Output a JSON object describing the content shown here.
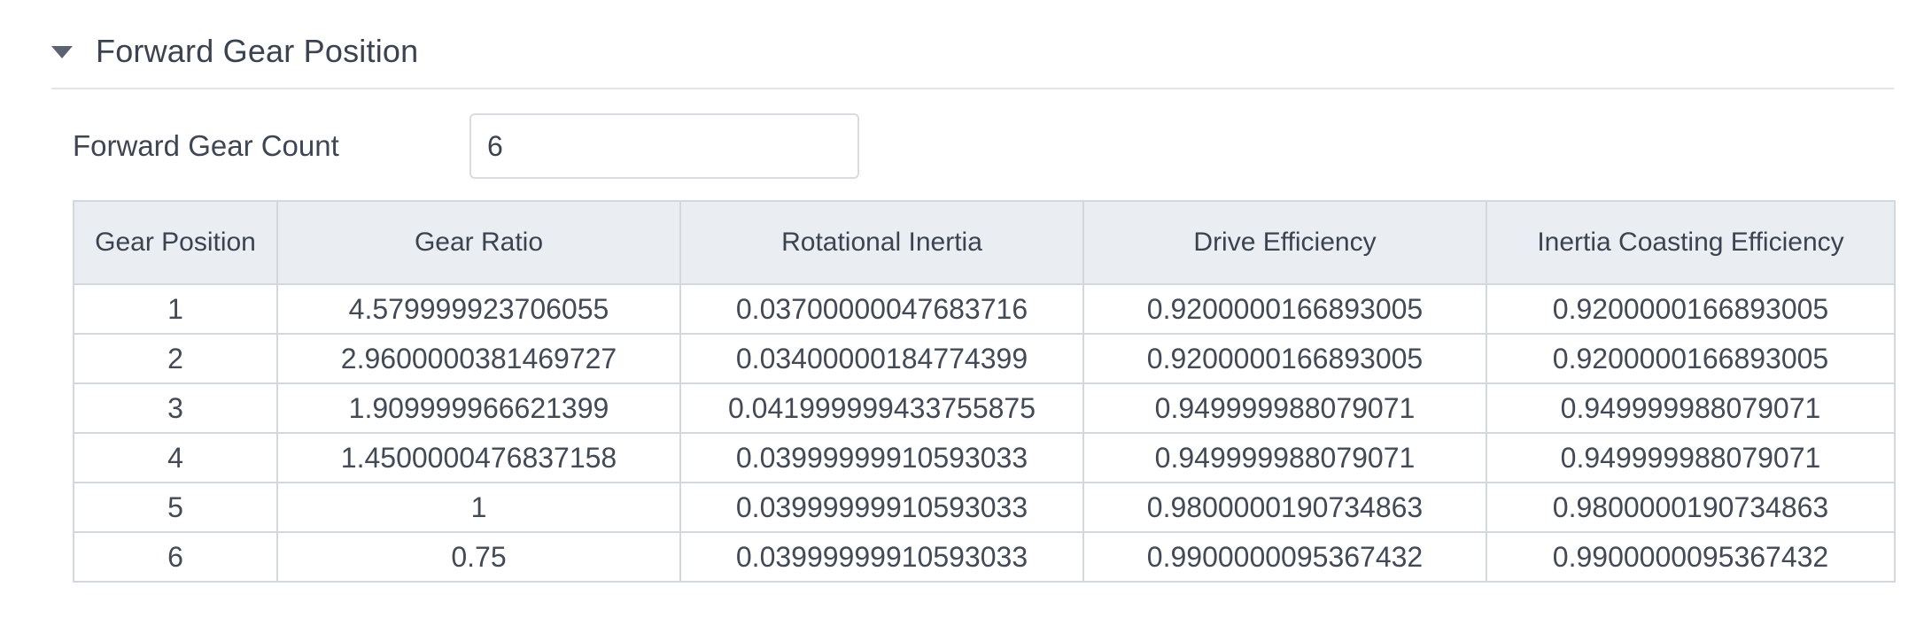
{
  "section": {
    "title": "Forward Gear Position"
  },
  "field": {
    "label": "Forward Gear Count",
    "value": "6"
  },
  "table": {
    "headers": [
      "Gear Position",
      "Gear Ratio",
      "Rotational Inertia",
      "Drive Efficiency",
      "Inertia Coasting Efficiency"
    ],
    "rows": [
      [
        "1",
        "4.579999923706055",
        "0.03700000047683716",
        "0.9200000166893005",
        "0.9200000166893005"
      ],
      [
        "2",
        "2.9600000381469727",
        "0.03400000184774399",
        "0.9200000166893005",
        "0.9200000166893005"
      ],
      [
        "3",
        "1.909999966621399",
        "0.041999999433755875",
        "0.949999988079071",
        "0.949999988079071"
      ],
      [
        "4",
        "1.4500000476837158",
        "0.03999999910593033",
        "0.949999988079071",
        "0.949999988079071"
      ],
      [
        "5",
        "1",
        "0.03999999910593033",
        "0.9800000190734863",
        "0.9800000190734863"
      ],
      [
        "6",
        "0.75",
        "0.03999999910593033",
        "0.9900000095367432",
        "0.9900000095367432"
      ]
    ]
  },
  "colors": {
    "header_bg": "#eaedf1",
    "border": "#d3d7de",
    "text": "#3b4350"
  },
  "icons": {
    "section_toggle": "caret-down-icon"
  }
}
